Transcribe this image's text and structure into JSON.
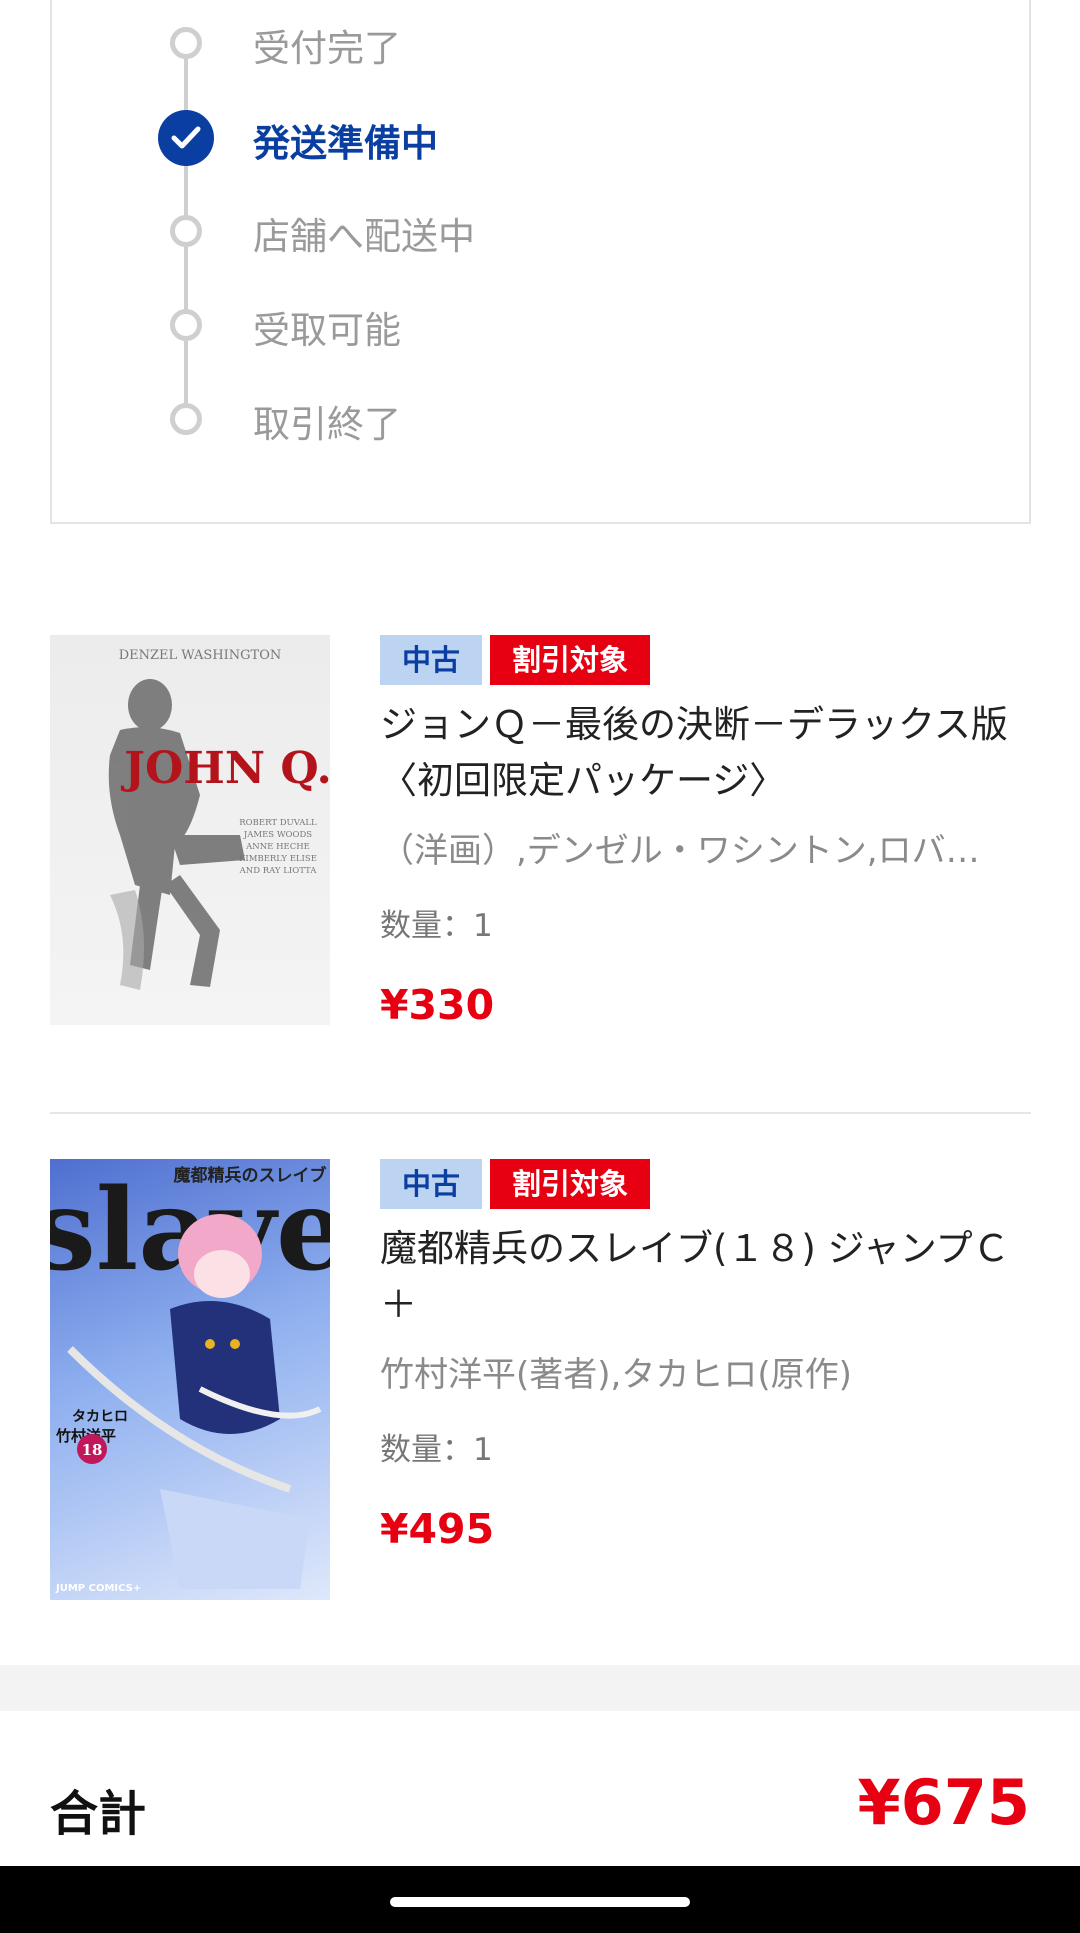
{
  "status": {
    "steps": [
      {
        "label": "受付完了",
        "active": false
      },
      {
        "label": "発送準備中",
        "active": true
      },
      {
        "label": "店舗へ配送中",
        "active": false
      },
      {
        "label": "受取可能",
        "active": false
      },
      {
        "label": "取引終了",
        "active": false
      }
    ]
  },
  "items": [
    {
      "badge_condition": "中古",
      "badge_discount": "割引対象",
      "title": "ジョンＱ－最後の決断－デラックス版〈初回限定パッケージ〉",
      "author": "（洋画）,デンゼル・ワシントン,ロバ…",
      "quantity": "数量：1",
      "price": "¥330",
      "cover": {
        "top_text": "DENZEL WASHINGTON",
        "title_text": "JOHN Q.",
        "credits": [
          "ROBERT DUVALL",
          "JAMES WOODS",
          "ANNE HECHE",
          "KIMBERLY ELISE",
          "AND RAY LIOTTA"
        ]
      }
    },
    {
      "badge_condition": "中古",
      "badge_discount": "割引対象",
      "title": "魔都精兵のスレイブ(１８) ジャンプＣ＋",
      "author": "竹村洋平(著者),タカヒロ(原作)",
      "quantity": "数量：1",
      "price": "¥495",
      "cover": {
        "top_text": "魔都精兵のスレイブ",
        "big_text": "slave",
        "credit1": "タカヒロ",
        "credit2": "竹村洋平",
        "volume": "18",
        "imprint": "JUMP COMICS+"
      }
    }
  ],
  "total": {
    "label": "合計",
    "price": "¥675"
  },
  "colors": {
    "accent": "#0a3ea0",
    "price": "#e60012",
    "badge_used_bg": "#bcd3f2"
  }
}
